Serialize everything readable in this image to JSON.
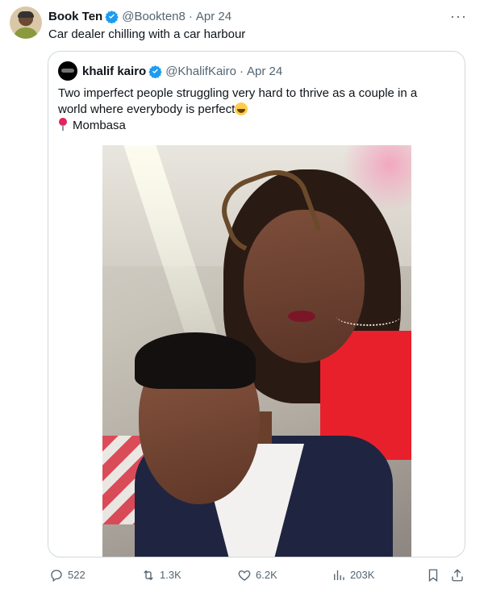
{
  "tweet": {
    "author_name": "Book Ten",
    "author_handle": "@Bookten8",
    "separator": "·",
    "date": "Apr 24",
    "more_label": "···",
    "text": "Car dealer chilling with a car harbour"
  },
  "quote": {
    "author_name": "khalif kairo",
    "author_handle": "@KhalifKairo",
    "separator": "·",
    "date": "Apr 24",
    "text_line1": "Two imperfect people struggling very hard to thrive as a couple in a",
    "text_line2": "world where everybody is perfect",
    "emoji": "grinning-face-emoji",
    "location": "Mombasa"
  },
  "actions": {
    "replies": "522",
    "reposts": "1.3K",
    "likes": "6.2K",
    "views": "203K"
  },
  "colors": {
    "verified": "#1d9bf0",
    "muted": "#536471",
    "border": "#cfd9de",
    "text": "#0f1419"
  }
}
